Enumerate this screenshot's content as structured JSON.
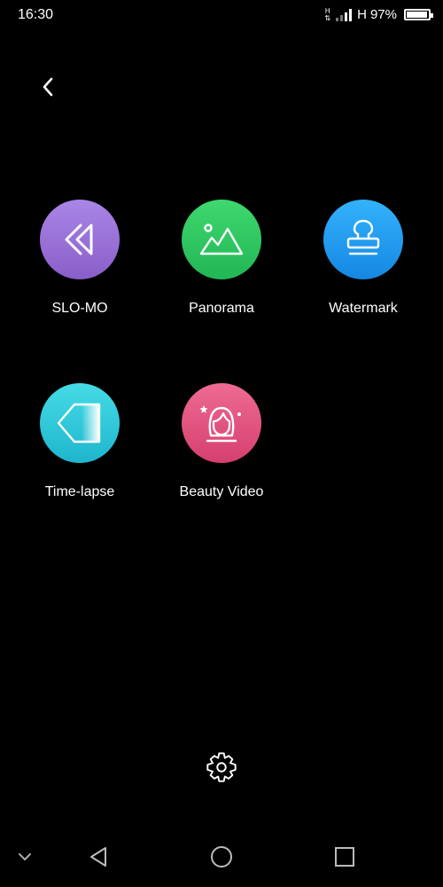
{
  "status_bar": {
    "time": "16:30",
    "network_small_top": "H",
    "network_small_bottom": "⇅",
    "network_type": "H",
    "battery_percent": "97%",
    "battery_level": 0.97
  },
  "modes": [
    {
      "label": "SLO-MO",
      "icon": "rewind-icon",
      "color": "#9a72d8"
    },
    {
      "label": "Panorama",
      "icon": "mountain-icon",
      "color": "#2ec862"
    },
    {
      "label": "Watermark",
      "icon": "stamp-icon",
      "color": "#1e9ff0"
    },
    {
      "label": "Time-lapse",
      "icon": "timelapse-icon",
      "color": "#2fc9d9"
    },
    {
      "label": "Beauty Video",
      "icon": "beauty-face-icon",
      "color": "#de4f7e"
    }
  ]
}
